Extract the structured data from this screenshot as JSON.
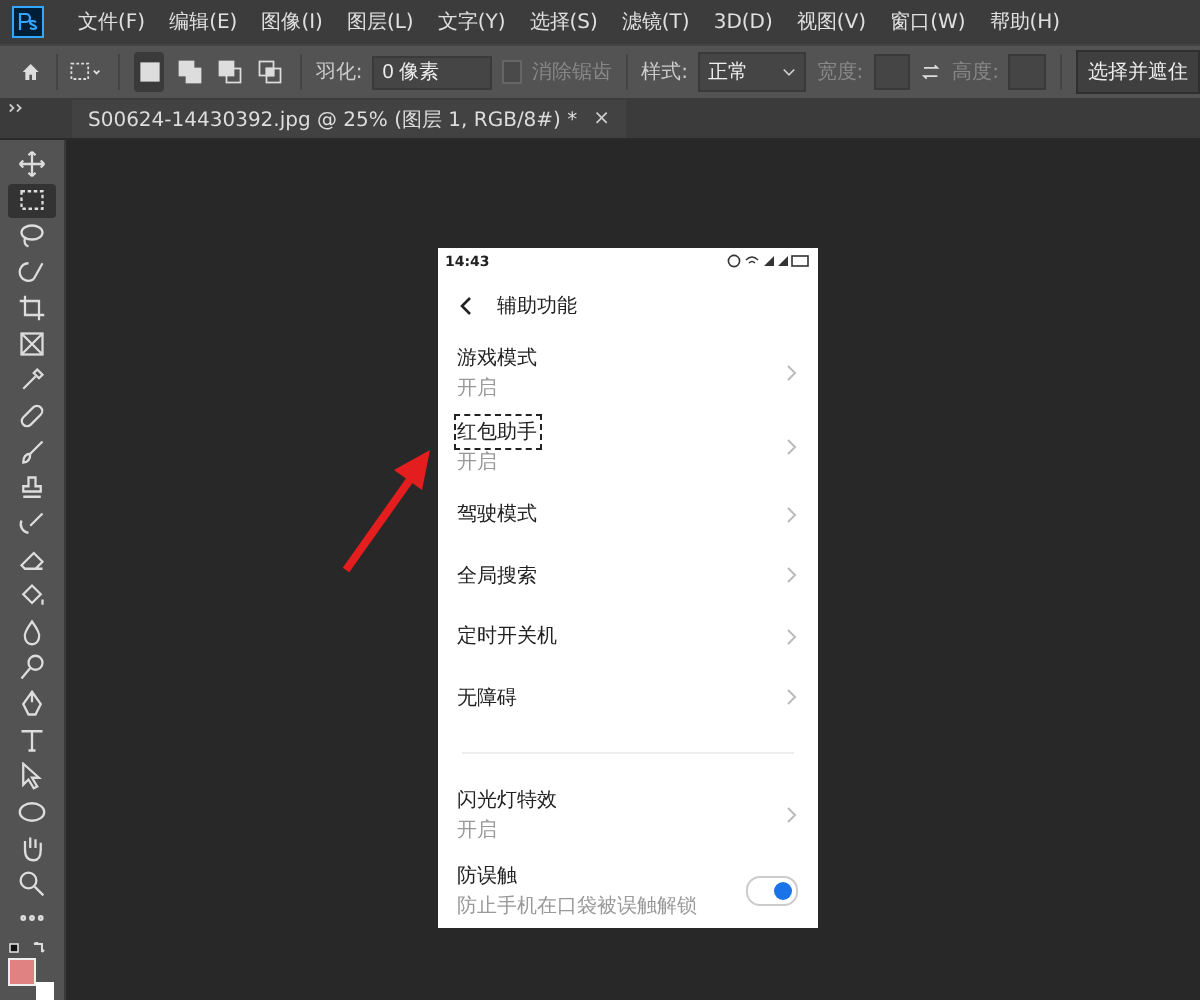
{
  "menu_bar": {
    "items": [
      "文件(F)",
      "编辑(E)",
      "图像(I)",
      "图层(L)",
      "文字(Y)",
      "选择(S)",
      "滤镜(T)",
      "3D(D)",
      "视图(V)",
      "窗口(W)",
      "帮助(H)"
    ]
  },
  "options_bar": {
    "modes": [
      {
        "kind": "new",
        "selected": true
      },
      {
        "kind": "add",
        "selected": false
      },
      {
        "kind": "subtract",
        "selected": false
      },
      {
        "kind": "intersect",
        "selected": false
      }
    ],
    "feather_label": "羽化:",
    "feather_value": "0 像素",
    "antialias": {
      "label": "消除锯齿",
      "checked": false,
      "disabled": true
    },
    "style_label": "样式:",
    "style_value": "正常",
    "width_label": "宽度:",
    "height_label": "高度:",
    "select_mask_button": "选择并遮住"
  },
  "document_tab": {
    "title": "S00624-14430392.jpg @ 25% (图层 1, RGB/8#) *",
    "close": "×"
  },
  "tools": [
    {
      "kind": "move",
      "selected": false
    },
    {
      "kind": "marquee",
      "selected": true
    },
    {
      "kind": "lasso",
      "selected": false
    },
    {
      "kind": "quick-select",
      "selected": false
    },
    {
      "kind": "crop",
      "selected": false
    },
    {
      "kind": "frame",
      "selected": false
    },
    {
      "kind": "eyedropper",
      "selected": false
    },
    {
      "kind": "bandage",
      "selected": false
    },
    {
      "kind": "brush",
      "selected": false
    },
    {
      "kind": "stamp",
      "selected": false
    },
    {
      "kind": "history-brush",
      "selected": false
    },
    {
      "kind": "eraser",
      "selected": false
    },
    {
      "kind": "bucket",
      "selected": false
    },
    {
      "kind": "drop",
      "selected": false
    },
    {
      "kind": "dodge",
      "selected": false
    },
    {
      "kind": "pen",
      "selected": false
    },
    {
      "kind": "type",
      "selected": false
    },
    {
      "kind": "pointer",
      "selected": false
    },
    {
      "kind": "ellipse",
      "selected": false
    },
    {
      "kind": "hand",
      "selected": false
    },
    {
      "kind": "zoom",
      "selected": false
    },
    {
      "kind": "more",
      "selected": false
    }
  ],
  "phone": {
    "time": "14:43",
    "title": "辅助功能",
    "rows": [
      {
        "kind": "link",
        "title": "游戏模式",
        "subtitle": "开启"
      },
      {
        "kind": "link",
        "title": "红包助手",
        "subtitle": "开启",
        "marquee": true
      },
      {
        "kind": "link",
        "title": "驾驶模式"
      },
      {
        "kind": "link",
        "title": "全局搜索"
      },
      {
        "kind": "link",
        "title": "定时开关机"
      },
      {
        "kind": "link",
        "title": "无障碍"
      },
      {
        "kind": "divider"
      },
      {
        "kind": "link",
        "title": "闪光灯特效",
        "subtitle": "开启"
      },
      {
        "kind": "toggle",
        "title": "防误触",
        "subtitle": "防止手机在口袋被误触解锁",
        "on": true
      }
    ]
  }
}
